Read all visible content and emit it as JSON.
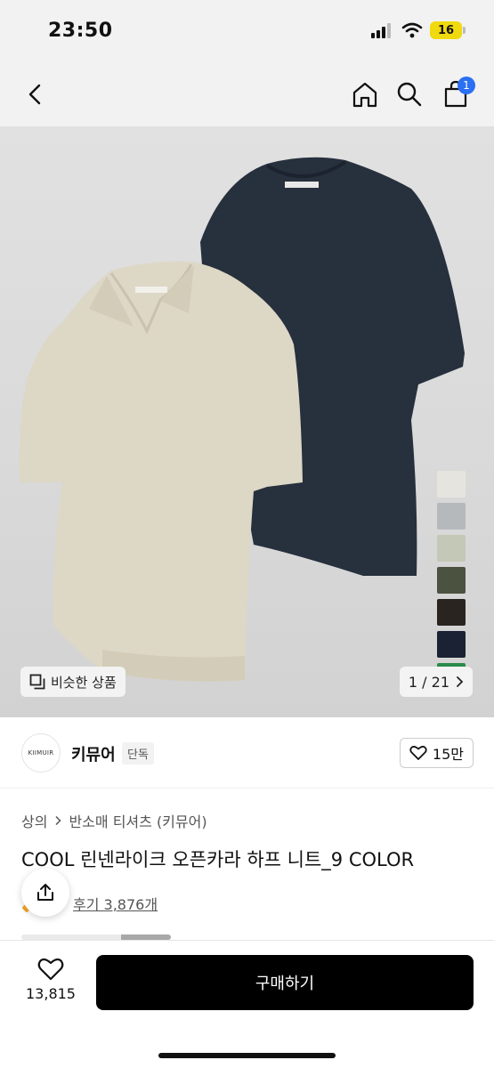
{
  "status_bar": {
    "time": "23:50",
    "battery": "16",
    "icons": [
      "signal-icon",
      "wifi-icon",
      "battery-icon"
    ]
  },
  "nav": {
    "back_icon": "chevron-left-icon",
    "home_icon": "home-icon",
    "search_icon": "search-icon",
    "cart_icon": "shopping-bag-icon",
    "cart_badge": "1"
  },
  "hero": {
    "similar_label": "비슷한 상품",
    "page_counter": "1 / 21",
    "swatch_colors": [
      "#e6e4df",
      "#b6b9bc",
      "#c4c8b6",
      "#4b5240",
      "#2a2421",
      "#1b2233",
      "#2b8a4a"
    ],
    "garment_colors": {
      "polo": "#ddd7c6",
      "knit": "#27303d"
    }
  },
  "brand": {
    "logo_text": "KIIMUIR",
    "name": "키뮤어",
    "tag": "단독",
    "like_count": "15만"
  },
  "product": {
    "breadcrumb": [
      "상의",
      "반소매 티셔츠 (키뮤어)"
    ],
    "title": "COOL 린넨라이크 오픈카라 하프 니트_9 COLOR",
    "review_label": "후기 3,876개"
  },
  "bottom": {
    "wish_count": "13,815",
    "buy_label": "구매하기"
  },
  "colors": {
    "accent": "#2b6ff3",
    "buy_button": "#000000"
  }
}
